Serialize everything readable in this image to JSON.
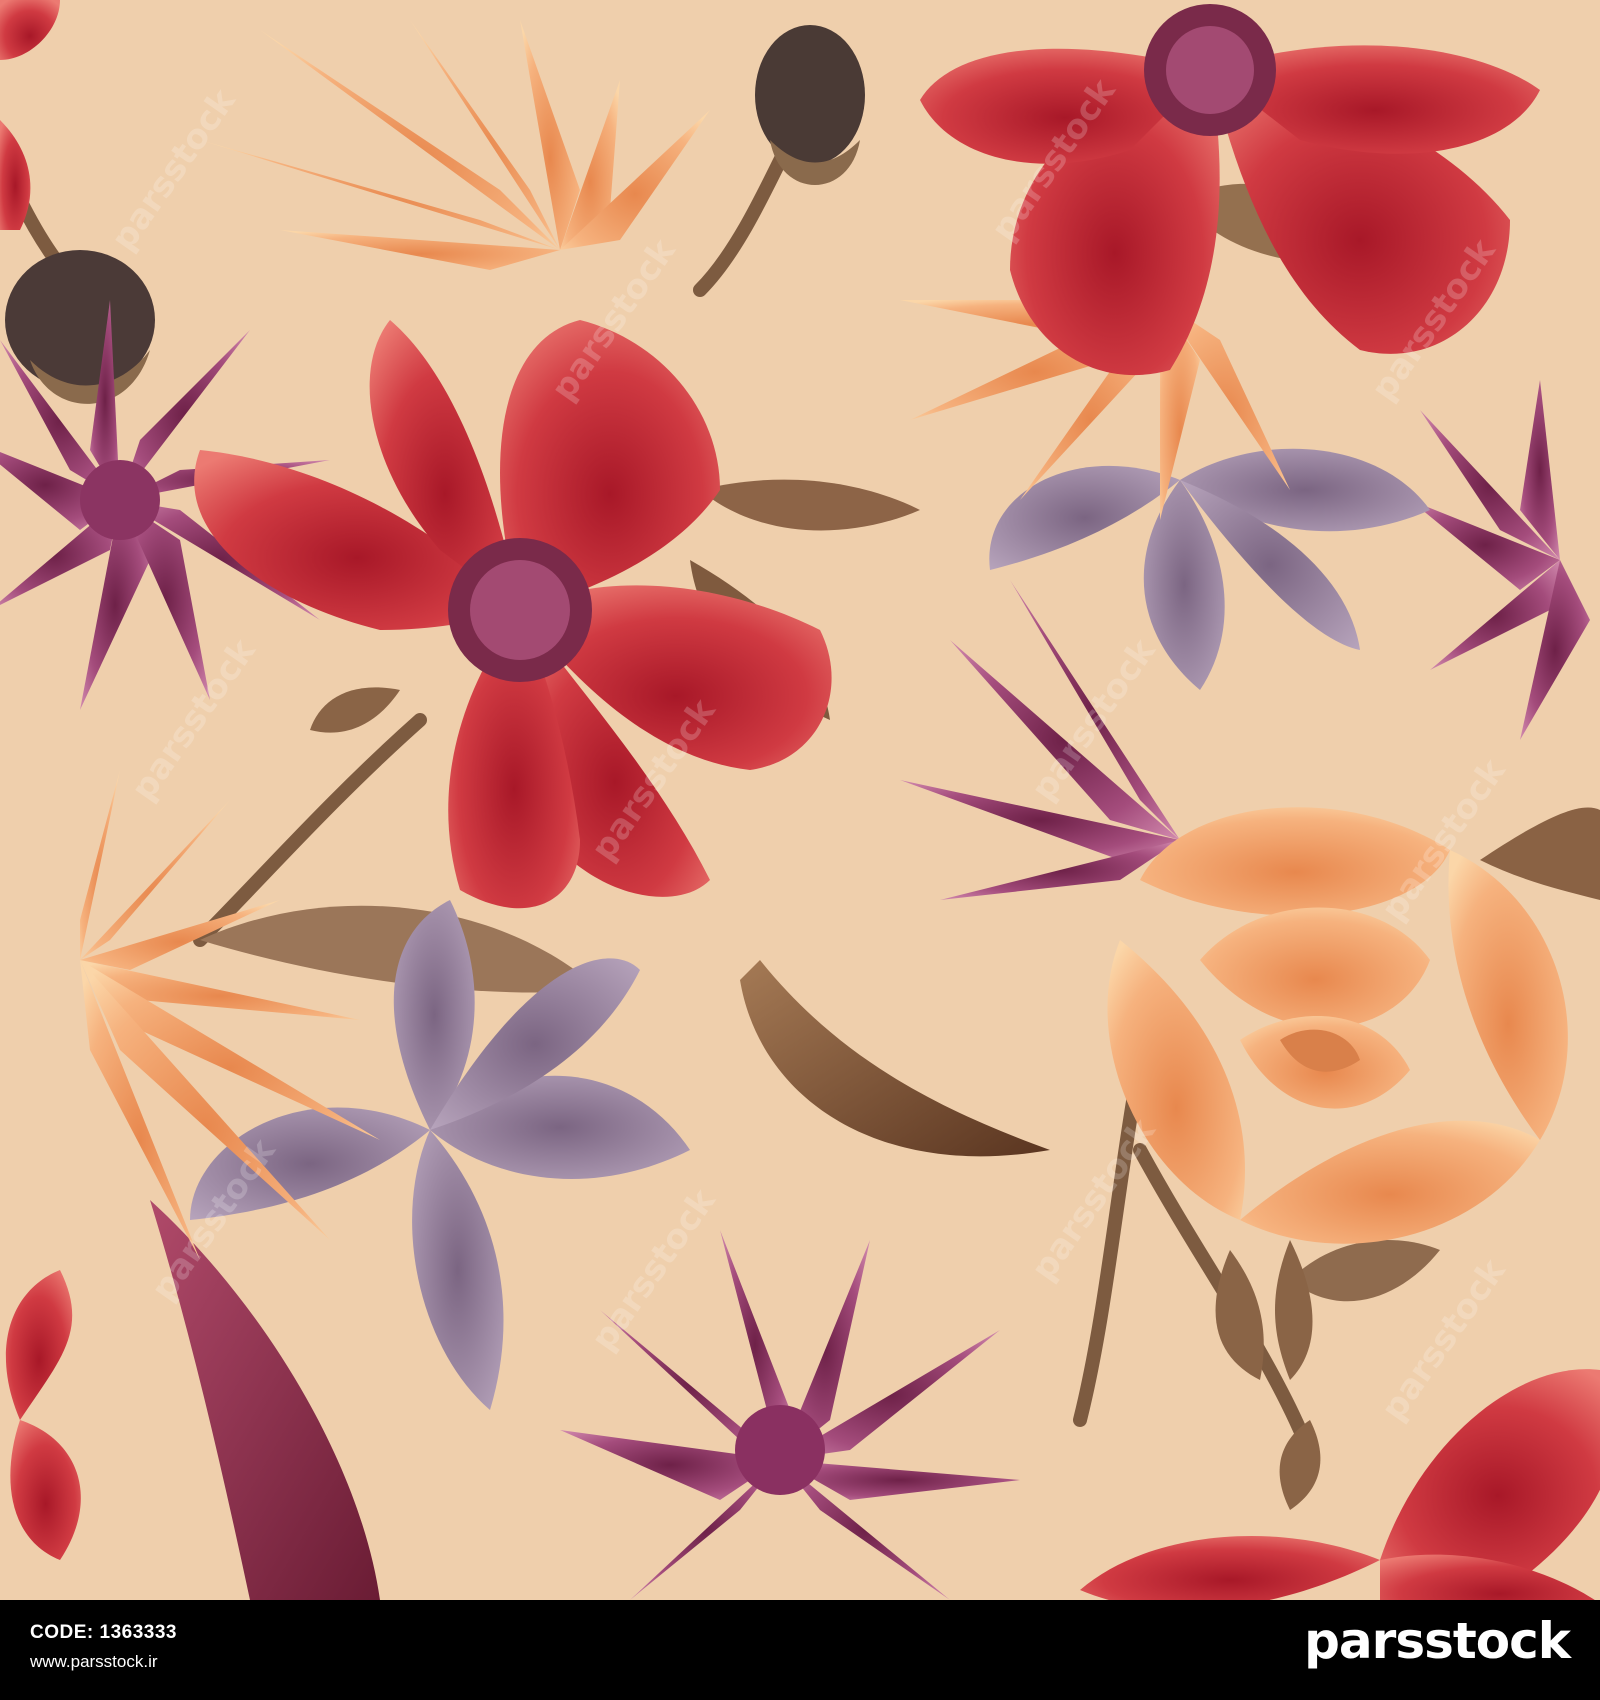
{
  "footer": {
    "code_label": "CODE:",
    "code_value": "1363333",
    "url": "www.parsstock.ir",
    "brand": "parsstock"
  },
  "watermark_text": "parsstock",
  "colors": {
    "background": "#efcfac",
    "footer_bg": "#000000",
    "red": "#c8303a",
    "orange": "#f3a770",
    "purple": "#a9507e",
    "lilac": "#9c8aa6",
    "brown": "#7a5234"
  }
}
